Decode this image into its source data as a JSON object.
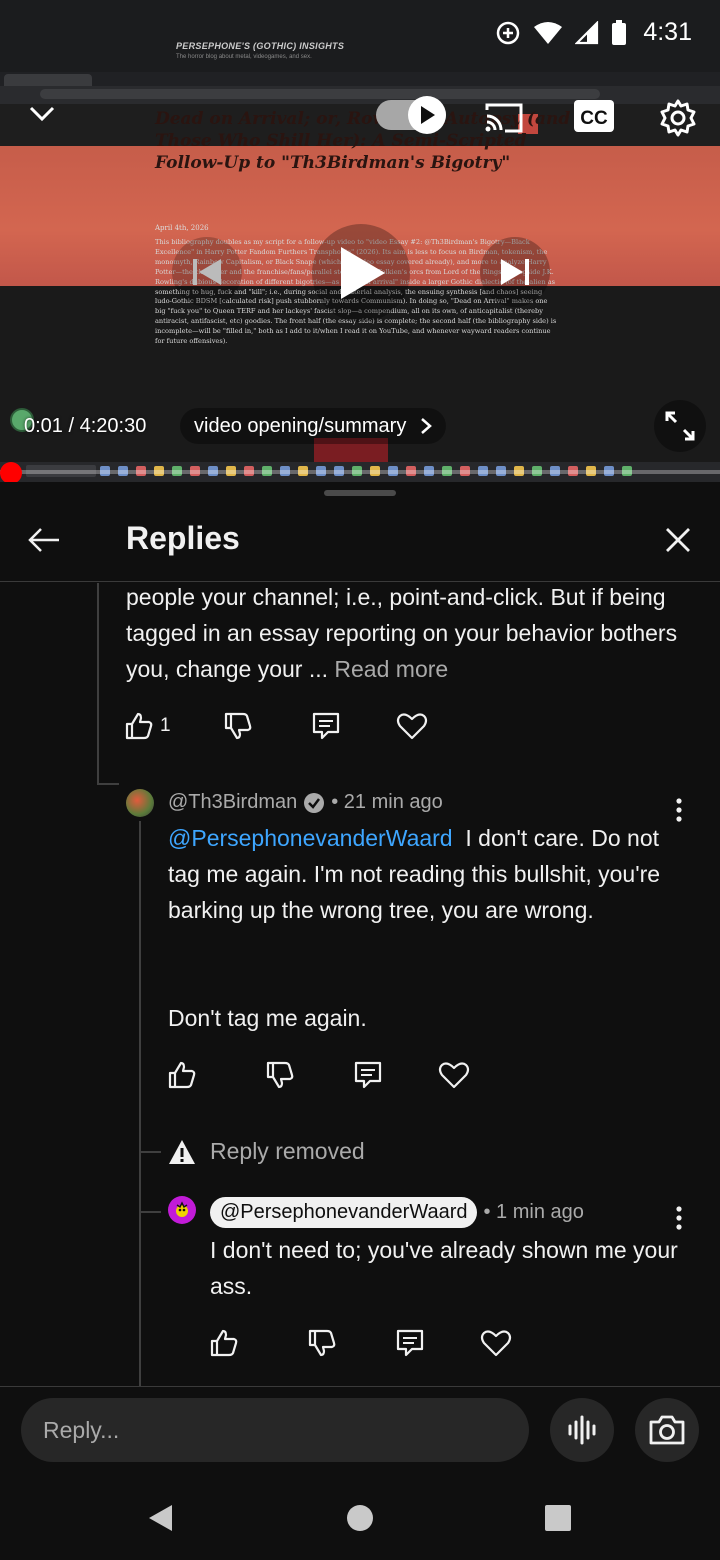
{
  "status_bar": {
    "time": "4:31"
  },
  "video": {
    "blog_title": "PERSEPHONE'S (GOTHIC) INSIGHTS",
    "blog_subtitle": "The horror blog about metal, videogames, and sex.",
    "article_title": "Dead on Arrival; or, Rowling's Autopsy (and Those Who Shill Her): A Semi-Scripted Follow-Up to \"Th3Birdman's Bigotry\"",
    "article_date": "April 4th, 2026",
    "article_text": "This bibliography doubles as my script for a follow-up video to \"video Essay #2: @Th3Birdman's Bigotry—Black Excellence\" in Harry Potter Fandom Furthers Transphobia\" (2026). Its aim is less to focus on Birdman, tokenism, the monomyth, Rainbow Capitalism, or Black Snape (which the video essay covered already), and more to analyze Harry Potter—the character and the franchise/fans/parallel stories (e.g., Tolkien's orcs from Lord of the Rings), alongside J.K. Rowling's dubious decoration of different bigotries—as \"dead on arrival\" inside a larger Gothic dialectic (of the alien as something to hug, fuck and \"kill\"; i.e., during social and material analysis, the ensuing synthesis [and chaos] seeing ludo-Gothic BDSM [calculated risk] push stubbornly towards Communism). In doing so, \"Dead on Arrival\" makes one big \"fuck you\" to Queen TERF and her lackeys' fascist slop—a compendium, all on its own, of anticapitalist (thereby antiracist, antifascist, etc) goodies. The front half (the essay side) is complete; the second half (the bibliography side) is incomplete—will be \"filled in,\" both as I add to it/when I read it on YouTube, and whenever wayward readers continue for future offensives).",
    "time_current": "0:01",
    "time_total": "4:20:30",
    "time_display": "0:01 / 4:20:30",
    "chapter_title": "video opening/summary",
    "progress": 0.0,
    "autoplay_on": true,
    "accent_color": "#ff0000"
  },
  "panel": {
    "title": "Replies",
    "back_icon": "arrow-left-icon",
    "close_icon": "close-icon"
  },
  "comments": [
    {
      "text": "people your channel; i.e., point-and-click. But if being tagged in an essay reporting on your behavior bothers you, change your ...",
      "read_more": "Read more",
      "like_count": "1"
    },
    {
      "author": "@Th3Birdman",
      "verified": true,
      "time": "• 21 min ago",
      "mention": "@PersephonevanderWaard",
      "text_first": "I don't care. Do not tag me again. I'm not reading this bullshit, you're barking up the wrong tree, you are wrong.",
      "text_second": "Don't tag me again."
    },
    {
      "removed_text": "Reply removed"
    },
    {
      "author": "@PersephonevanderWaard",
      "time": "• 1 min ago",
      "text": "I don't need to; you've already shown me your ass."
    }
  ],
  "reply_input": {
    "placeholder": "Reply..."
  },
  "colors": {
    "background": "#0f0f0f",
    "text": "#f1f1f1",
    "secondary_text": "#aaaaaa",
    "mention": "#3ea6ff",
    "progress": "#ff0000"
  }
}
